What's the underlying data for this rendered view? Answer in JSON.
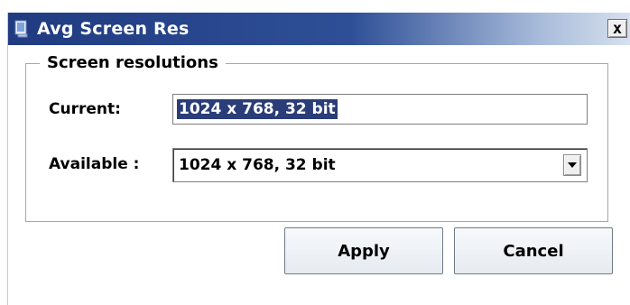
{
  "window": {
    "title": "Avg Screen Res",
    "close_label": "x"
  },
  "group": {
    "legend": "Screen resolutions"
  },
  "fields": {
    "current_label": "Current:",
    "current_value": "1024 x 768, 32 bit",
    "available_label": "Available :",
    "available_value": "1024 x 768, 32 bit"
  },
  "buttons": {
    "apply": "Apply",
    "cancel": "Cancel"
  },
  "colors": {
    "titlebar_dark": "#203b80",
    "titlebar_light": "#d7e1ef",
    "selection": "#2a3d78"
  }
}
